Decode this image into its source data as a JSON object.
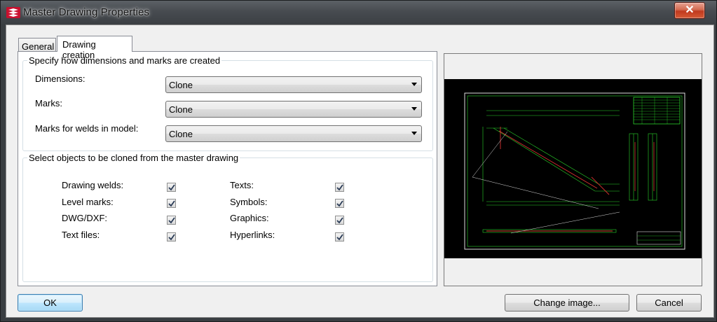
{
  "window": {
    "title": "Master Drawing Properties",
    "close_icon": "close-x-icon"
  },
  "tabs": [
    {
      "label": "General",
      "active": false
    },
    {
      "label": "Drawing creation",
      "active": true
    }
  ],
  "dimensions_group": {
    "title": "Specify how dimensions and marks are created",
    "rows": [
      {
        "label": "Dimensions:",
        "value": "Clone"
      },
      {
        "label": "Marks:",
        "value": "Clone"
      },
      {
        "label": "Marks for welds in model:",
        "value": "Clone"
      }
    ]
  },
  "clone_group": {
    "title": "Select objects to be cloned from the master drawing",
    "left": [
      {
        "label": "Drawing welds:",
        "checked": true
      },
      {
        "label": "Level marks:",
        "checked": true
      },
      {
        "label": "DWG/DXF:",
        "checked": true
      },
      {
        "label": "Text files:",
        "checked": true
      }
    ],
    "right": [
      {
        "label": "Texts:",
        "checked": true
      },
      {
        "label": "Symbols:",
        "checked": true
      },
      {
        "label": "Graphics:",
        "checked": true
      },
      {
        "label": "Hyperlinks:",
        "checked": true
      }
    ]
  },
  "preview": {
    "description": "drawing-preview-image",
    "background": "#000000",
    "line_color": "#2bd42b",
    "accent_color": "#d83030"
  },
  "buttons": {
    "ok": "OK",
    "change_image": "Change image...",
    "cancel": "Cancel"
  }
}
